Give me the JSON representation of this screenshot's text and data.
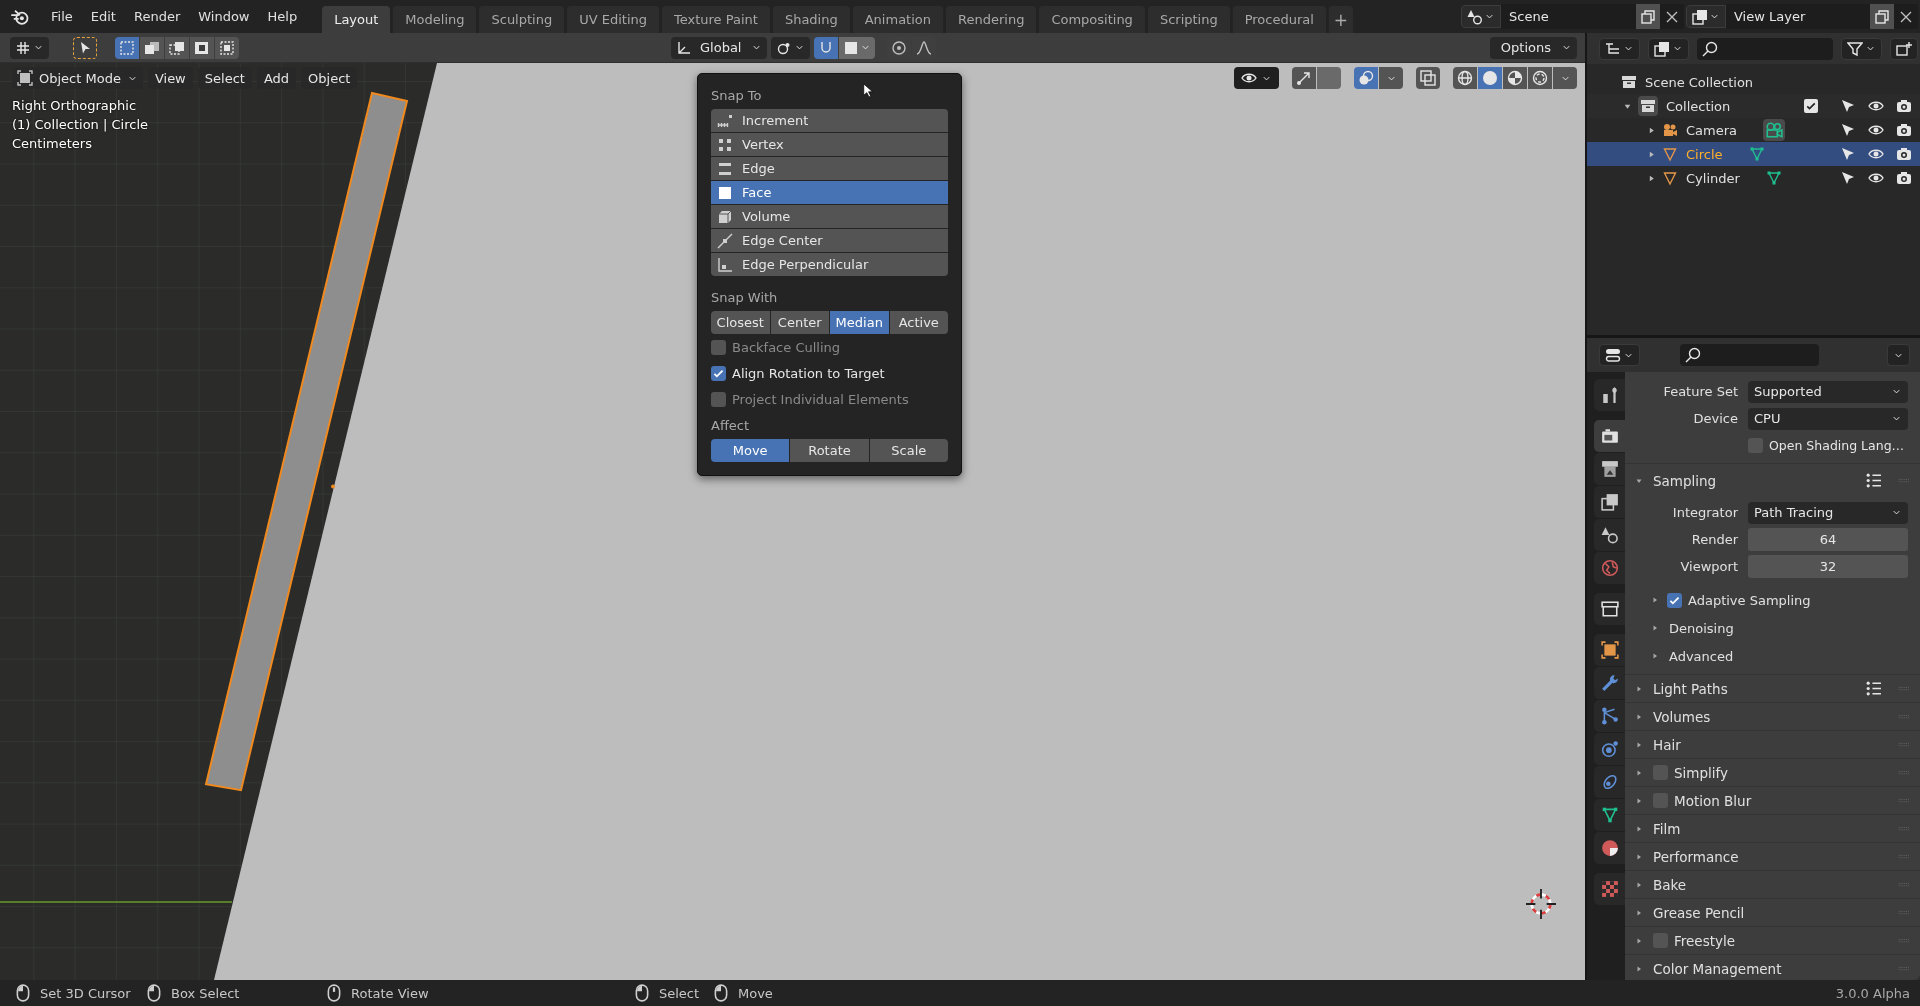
{
  "menu": [
    "File",
    "Edit",
    "Render",
    "Window",
    "Help"
  ],
  "workspaces": [
    {
      "label": "Layout",
      "selected": true
    },
    {
      "label": "Modeling",
      "selected": false
    },
    {
      "label": "Sculpting",
      "selected": false
    },
    {
      "label": "UV Editing",
      "selected": false
    },
    {
      "label": "Texture Paint",
      "selected": false
    },
    {
      "label": "Shading",
      "selected": false
    },
    {
      "label": "Animation",
      "selected": false
    },
    {
      "label": "Rendering",
      "selected": false
    },
    {
      "label": "Compositing",
      "selected": false
    },
    {
      "label": "Scripting",
      "selected": false
    },
    {
      "label": "Procedural",
      "selected": false
    }
  ],
  "add_workspace": "+",
  "scene": {
    "name": "Scene"
  },
  "view_layer": {
    "name": "View Layer"
  },
  "tool_header": {
    "select_modes": [
      {
        "selected": true
      },
      {
        "selected": false
      },
      {
        "selected": false
      },
      {
        "selected": false
      },
      {
        "selected": false
      }
    ],
    "orientation": "Global",
    "snap": {
      "on": true
    },
    "proportional": {
      "on": false
    },
    "options": "Options"
  },
  "viewport_header": {
    "mode": "Object Mode",
    "menus": [
      "View",
      "Select",
      "Add",
      "Object"
    ],
    "gizmos": {
      "on": false
    },
    "overlays": {
      "on": true
    },
    "xray": {
      "on": false
    },
    "shading": [
      {
        "kind": "wireframe",
        "selected": false
      },
      {
        "kind": "solid",
        "selected": true
      },
      {
        "kind": "material",
        "selected": false
      },
      {
        "kind": "rendered",
        "selected": false
      }
    ]
  },
  "viewport_text": [
    "Right Orthographic",
    "(1) Collection | Circle",
    "Centimeters"
  ],
  "snap_popup": {
    "snap_to_title": "Snap To",
    "snap_to": [
      {
        "kind": "increment",
        "label": "Increment",
        "selected": false
      },
      {
        "kind": "vertex",
        "label": "Vertex",
        "selected": false
      },
      {
        "kind": "edge",
        "label": "Edge",
        "selected": false
      },
      {
        "kind": "face",
        "label": "Face",
        "selected": true
      },
      {
        "kind": "volume",
        "label": "Volume",
        "selected": false
      },
      {
        "kind": "edge_center",
        "label": "Edge Center",
        "selected": false
      },
      {
        "kind": "edge_perpendicular",
        "label": "Edge Perpendicular",
        "selected": false
      }
    ],
    "snap_with_title": "Snap With",
    "snap_with": [
      {
        "label": "Closest",
        "selected": false
      },
      {
        "label": "Center",
        "selected": false
      },
      {
        "label": "Median",
        "selected": true
      },
      {
        "label": "Active",
        "selected": false
      }
    ],
    "options": [
      {
        "label": "Backface Culling",
        "checked": false,
        "disabled": true
      },
      {
        "label": "Align Rotation to Target",
        "checked": true,
        "disabled": false
      },
      {
        "label": "Project Individual Elements",
        "checked": false,
        "disabled": true
      }
    ],
    "affect_title": "Affect",
    "affect": [
      {
        "label": "Move",
        "selected": true
      },
      {
        "label": "Rotate",
        "selected": false
      },
      {
        "label": "Scale",
        "selected": false
      }
    ]
  },
  "outliner": {
    "root": "Scene Collection",
    "collections": [
      {
        "label": "Collection",
        "expanded": true,
        "checked": true,
        "children": [
          {
            "label": "Camera",
            "kind": "camera",
            "expanded": false,
            "selected": false
          },
          {
            "label": "Circle",
            "kind": "mesh",
            "expanded": false,
            "selected": true
          },
          {
            "label": "Cylinder",
            "kind": "mesh",
            "expanded": false,
            "selected": false
          }
        ]
      }
    ]
  },
  "property_tabs": [
    {
      "kind": "tool",
      "selected": false
    },
    {
      "kind": "render",
      "selected": true
    },
    {
      "kind": "output",
      "selected": false
    },
    {
      "kind": "view_layer",
      "selected": false
    },
    {
      "kind": "scene",
      "selected": false
    },
    {
      "kind": "world",
      "selected": false
    },
    {
      "kind": "collection",
      "selected": false
    },
    {
      "kind": "object",
      "selected": false
    },
    {
      "kind": "modifiers",
      "selected": false
    },
    {
      "kind": "particles",
      "selected": false
    },
    {
      "kind": "physics",
      "selected": false
    },
    {
      "kind": "constraints",
      "selected": false
    },
    {
      "kind": "data",
      "selected": false
    },
    {
      "kind": "material",
      "selected": false
    },
    {
      "kind": "texture",
      "selected": false
    }
  ],
  "properties": {
    "fields": [
      {
        "label": "Feature Set",
        "value": "Supported"
      },
      {
        "label": "Device",
        "value": "CPU"
      }
    ],
    "osl": {
      "label": "Open Shading Lang…",
      "checked": false
    },
    "panels": [
      {
        "title": "Sampling",
        "expanded": true,
        "presets": true,
        "fields": [
          {
            "kind": "dropdown",
            "label": "Integrator",
            "value": "Path Tracing"
          },
          {
            "kind": "number",
            "label": "Render",
            "value": "64"
          },
          {
            "kind": "number",
            "label": "Viewport",
            "value": "32"
          }
        ],
        "subpanels": [
          {
            "title": "Adaptive Sampling",
            "checked": true
          },
          {
            "title": "Denoising"
          },
          {
            "title": "Advanced"
          }
        ]
      },
      {
        "title": "Light Paths",
        "expanded": false,
        "presets": true
      },
      {
        "title": "Volumes",
        "expanded": false,
        "presets": false
      },
      {
        "title": "Hair",
        "expanded": false,
        "presets": false
      },
      {
        "title": "Simplify",
        "expanded": false,
        "presets": false,
        "checked": false
      },
      {
        "title": "Motion Blur",
        "expanded": false,
        "presets": false,
        "checked": false
      },
      {
        "title": "Film",
        "expanded": false,
        "presets": false
      },
      {
        "title": "Performance",
        "expanded": false,
        "presets": false
      },
      {
        "title": "Bake",
        "expanded": false,
        "presets": false
      },
      {
        "title": "Grease Pencil",
        "expanded": false,
        "presets": false
      },
      {
        "title": "Freestyle",
        "expanded": false,
        "presets": false,
        "checked": false
      },
      {
        "title": "Color Management",
        "expanded": false,
        "presets": false
      }
    ]
  },
  "status_bar": {
    "hints": [
      {
        "kind": "left",
        "label": "Set 3D Cursor"
      },
      {
        "kind": "left",
        "label": "Box Select"
      },
      {
        "kind": "middle",
        "label": "Rotate View"
      },
      {
        "kind": "left",
        "label": "Select"
      },
      {
        "kind": "left",
        "label": "Move"
      }
    ],
    "version": "3.0.0 Alpha"
  }
}
